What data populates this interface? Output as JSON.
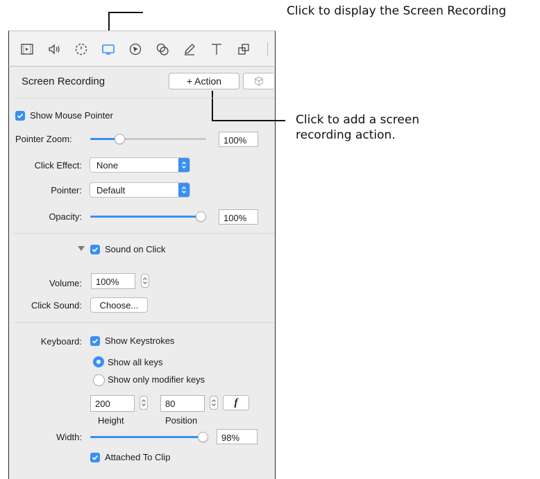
{
  "annotations": {
    "top": "Click to display the Screen Recording",
    "action_line1": "Click to add a screen",
    "action_line2": "recording action."
  },
  "toolbar": {
    "icons": [
      "filmstrip-icon",
      "speaker-icon",
      "dashed-circle-icon",
      "screen-icon",
      "pointer-cursor-icon",
      "overlap-circles-icon",
      "pencil-icon",
      "text-T-icon",
      "layers-icon"
    ],
    "active_icon": "screen-icon",
    "accent": "#3a8ff0"
  },
  "header": {
    "title": "Screen Recording",
    "action_button": "+ Action"
  },
  "pointer": {
    "show_pointer_label": "Show Mouse Pointer",
    "show_pointer_checked": true,
    "zoom_label": "Pointer Zoom:",
    "zoom_value": "100%",
    "zoom_level": 0.25,
    "click_effect_label": "Click Effect:",
    "click_effect_value": "None",
    "pointer_label": "Pointer:",
    "pointer_value": "Default",
    "opacity_label": "Opacity:",
    "opacity_value": "100%",
    "opacity_level": 1.0
  },
  "sound": {
    "sound_on_click_label": "Sound on Click",
    "sound_on_click_checked": true,
    "volume_label": "Volume:",
    "volume_value": "100%",
    "click_sound_label": "Click Sound:",
    "choose_button": "Choose..."
  },
  "keyboard": {
    "label": "Keyboard:",
    "show_keystrokes_label": "Show Keystrokes",
    "show_keystrokes_checked": true,
    "radio_all": "Show all keys",
    "radio_modifier": "Show only modifier keys",
    "selected_radio": "Show all keys",
    "height_value": "200",
    "position_value": "80",
    "function_button": "f",
    "height_label": "Height",
    "position_label": "Position",
    "width_label": "Width:",
    "width_value": "98%",
    "width_level": 0.98,
    "attached_label": "Attached To Clip",
    "attached_checked": true
  }
}
